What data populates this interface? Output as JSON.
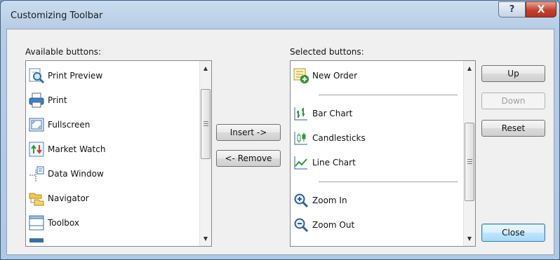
{
  "window": {
    "title": "Customizing Toolbar",
    "help_glyph": "?",
    "close_glyph": "X"
  },
  "available": {
    "label": "Available buttons:",
    "items": [
      {
        "label": "Print Preview",
        "icon": "print-preview-icon"
      },
      {
        "label": "Print",
        "icon": "printer-icon"
      },
      {
        "label": "Fullscreen",
        "icon": "fullscreen-icon"
      },
      {
        "label": "Market Watch",
        "icon": "market-watch-icon"
      },
      {
        "label": "Data Window",
        "icon": "data-window-icon"
      },
      {
        "label": "Navigator",
        "icon": "navigator-folder-icon"
      },
      {
        "label": "Toolbox",
        "icon": "toolbox-icon"
      }
    ]
  },
  "selected": {
    "label": "Selected buttons:",
    "items": [
      {
        "label": "New Order",
        "icon": "new-order-icon"
      },
      {
        "label": "Bar Chart",
        "icon": "bar-chart-icon"
      },
      {
        "label": "Candlesticks",
        "icon": "candlesticks-icon"
      },
      {
        "label": "Line Chart",
        "icon": "line-chart-icon"
      },
      {
        "label": "Zoom In",
        "icon": "zoom-in-icon"
      },
      {
        "label": "Zoom Out",
        "icon": "zoom-out-icon"
      }
    ]
  },
  "buttons": {
    "insert": "Insert ->",
    "remove": "<- Remove",
    "up": "Up",
    "down": "Down",
    "reset": "Reset",
    "close": "Close"
  },
  "colors": {
    "title_bg": "#b7cde6",
    "close_button": "#c4402c",
    "default_button_border": "#3c7fb1"
  }
}
